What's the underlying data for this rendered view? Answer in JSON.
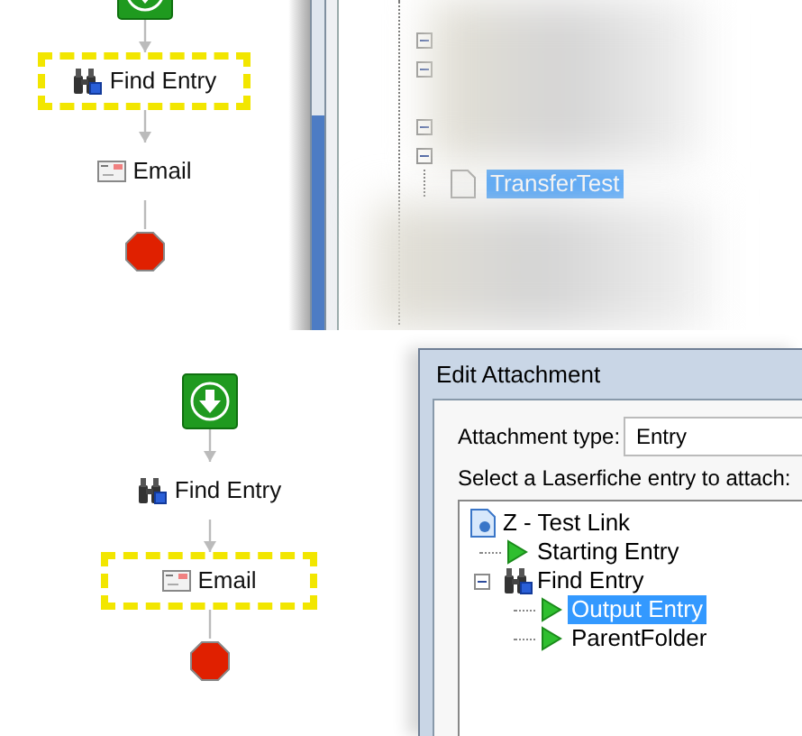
{
  "top_panel": {
    "workflow": [
      {
        "kind": "start"
      },
      {
        "kind": "find",
        "label": "Find Entry",
        "selected": true
      },
      {
        "kind": "email",
        "label": "Email",
        "selected": false
      },
      {
        "kind": "stop"
      }
    ],
    "tree": [
      {
        "kind": "node",
        "expanded": true
      },
      {
        "kind": "node",
        "expanded": true
      },
      {
        "kind": "node",
        "expanded": true
      },
      {
        "kind": "node",
        "expanded": true
      },
      {
        "kind": "document",
        "label": "TransferTest",
        "selected": true
      }
    ]
  },
  "bottom_panel": {
    "workflow": [
      {
        "kind": "start"
      },
      {
        "kind": "find",
        "label": "Find Entry",
        "selected": false
      },
      {
        "kind": "email",
        "label": "Email",
        "selected": true
      },
      {
        "kind": "stop"
      }
    ],
    "dialog": {
      "title": "Edit Attachment",
      "attachment_type_label": "Attachment type:",
      "attachment_type": "Entry",
      "prompt": "Select a Laserfiche entry to attach:",
      "tree": [
        {
          "kind": "workflow",
          "label": "Z - Test Link",
          "selected": false,
          "children": [
            {
              "kind": "entry",
              "label": "Starting Entry",
              "selected": false
            },
            {
              "kind": "find",
              "label": "Find Entry",
              "selected": false,
              "expanded": true,
              "children": [
                {
                  "kind": "entry",
                  "label": "Output Entry",
                  "selected": true
                },
                {
                  "kind": "entry",
                  "label": "ParentFolder",
                  "selected": false
                }
              ]
            }
          ]
        }
      ]
    }
  }
}
